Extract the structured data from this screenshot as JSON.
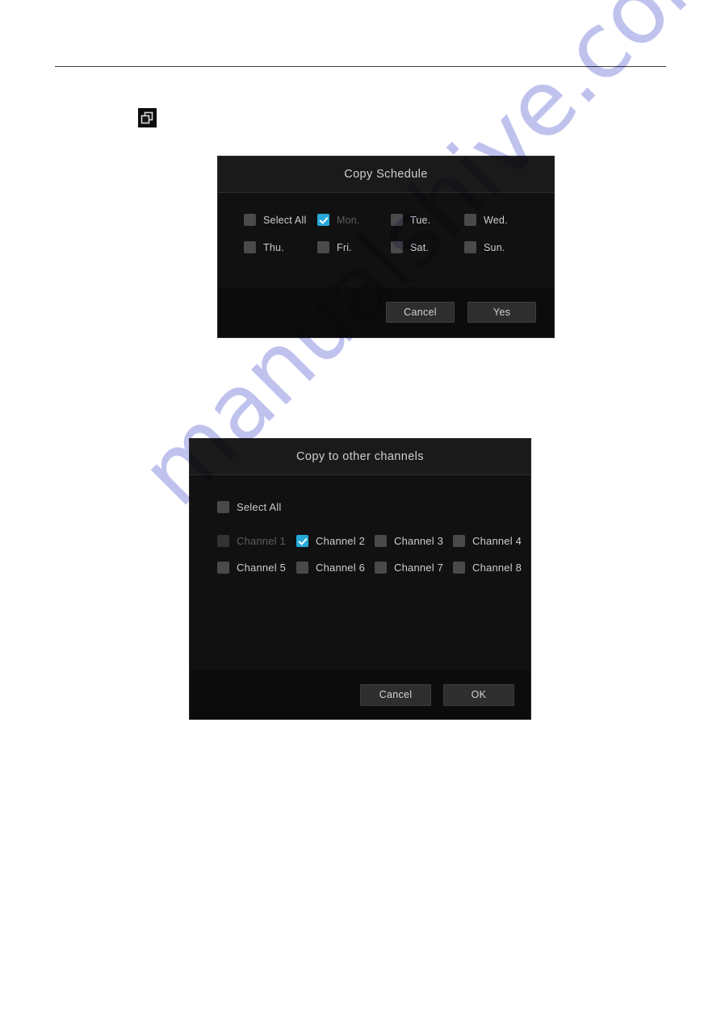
{
  "page": {
    "watermark": "manualshive.com",
    "copy_icon_name": "copy-icon"
  },
  "copy_schedule_dialog": {
    "title": "Copy Schedule",
    "days": [
      {
        "label": "Select All",
        "checked": false,
        "disabled": false
      },
      {
        "label": "Mon.",
        "checked": true,
        "disabled": true
      },
      {
        "label": "Tue.",
        "checked": false,
        "disabled": false
      },
      {
        "label": "Wed.",
        "checked": false,
        "disabled": false
      },
      {
        "label": "Thu.",
        "checked": false,
        "disabled": false
      },
      {
        "label": "Fri.",
        "checked": false,
        "disabled": false
      },
      {
        "label": "Sat.",
        "checked": false,
        "disabled": false
      },
      {
        "label": "Sun.",
        "checked": false,
        "disabled": false
      }
    ],
    "cancel_label": "Cancel",
    "confirm_label": "Yes"
  },
  "copy_channels_dialog": {
    "title": "Copy to other channels",
    "select_all": {
      "label": "Select All",
      "checked": false,
      "disabled": false
    },
    "channels": [
      {
        "label": "Channel 1",
        "checked": false,
        "disabled": true
      },
      {
        "label": "Channel 2",
        "checked": true,
        "disabled": false
      },
      {
        "label": "Channel 3",
        "checked": false,
        "disabled": false
      },
      {
        "label": "Channel 4",
        "checked": false,
        "disabled": false
      },
      {
        "label": "Channel 5",
        "checked": false,
        "disabled": false
      },
      {
        "label": "Channel 6",
        "checked": false,
        "disabled": false
      },
      {
        "label": "Channel 7",
        "checked": false,
        "disabled": false
      },
      {
        "label": "Channel 8",
        "checked": false,
        "disabled": false
      }
    ],
    "cancel_label": "Cancel",
    "confirm_label": "OK"
  },
  "colors": {
    "checkbox_checked": "#26a9d8",
    "checkbox_unchecked": "#4a4a4a",
    "dialog_bg": "#111111",
    "dialog_title_bg": "#1a1a1a",
    "button_bg": "#2e2e2e",
    "watermark": "#8b8fe0"
  }
}
